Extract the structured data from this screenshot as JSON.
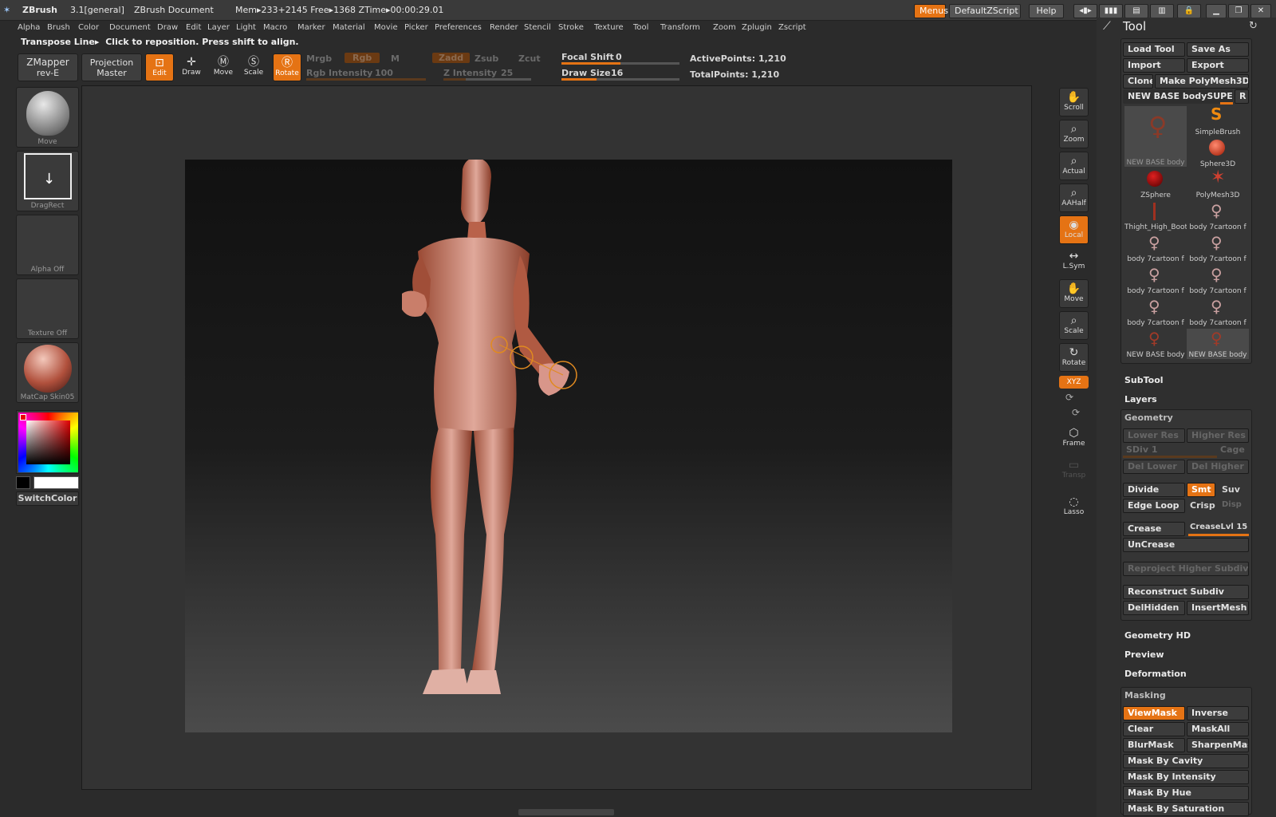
{
  "titlebar": {
    "app": "ZBrush",
    "version": "3.1[general]",
    "document": "ZBrush Document",
    "mem": "Mem▸233+2145 Free▸1368 ZTime▸00:00:29.01",
    "menus_btn": "Menus",
    "script_btn": "DefaultZScript",
    "help_btn": "Help"
  },
  "menus": [
    "Alpha",
    "Brush",
    "Color",
    "Document",
    "Draw",
    "Edit",
    "Layer",
    "Light",
    "Macro",
    "Marker",
    "Material",
    "Movie",
    "Picker",
    "Preferences",
    "Render",
    "Stencil",
    "Stroke",
    "Texture",
    "Tool",
    "Transform",
    "Zoom",
    "Zplugin",
    "Zscript"
  ],
  "status": {
    "label": "Transpose Line▸",
    "text": "Click to reposition. Press shift to align."
  },
  "toolbar": {
    "zmapper": "ZMapper",
    "zmapper_sub": "rev-E",
    "projection": "Projection",
    "projection_sub": "Master",
    "edit": "Edit",
    "draw": "Draw",
    "move": "Move",
    "scale": "Scale",
    "rotate": "Rotate",
    "mrgb": "Mrgb",
    "rgb": "Rgb",
    "m": "M",
    "zadd": "Zadd",
    "zsub": "Zsub",
    "zcut": "Zcut",
    "rgb_intensity_label": "Rgb Intensity",
    "rgb_intensity": "100",
    "z_intensity_label": "Z Intensity",
    "z_intensity": "25",
    "focal_shift_label": "Focal Shift",
    "focal_shift": "0",
    "draw_size_label": "Draw Size",
    "draw_size": "16",
    "active_points": "ActivePoints: 1,210",
    "total_points": "TotalPoints: 1,210"
  },
  "shelf": {
    "brush": "Move",
    "stroke": "DragRect",
    "alpha": "Alpha Off",
    "texture": "Texture Off",
    "material": "MatCap Skin05",
    "switch_color": "SwitchColor"
  },
  "nav": [
    "Scroll",
    "Zoom",
    "Actual",
    "AAHalf",
    "Local",
    "L.Sym",
    "Move",
    "Scale",
    "Rotate",
    "XYZ",
    "Frame",
    "Transp",
    "Lasso"
  ],
  "palette": {
    "title": "Tool",
    "load_tool": "Load Tool",
    "save_as": "Save As",
    "import": "Import",
    "export": "Export",
    "clone": "Clone",
    "make_polymesh": "Make PolyMesh3D",
    "current_tool": "NEW BASE bodySUPERGI",
    "r": "R",
    "thumbs": [
      "NEW BASE body",
      "SimpleBrush",
      "Sphere3D",
      "ZSphere",
      "PolyMesh3D",
      "Thight_High_Boot",
      "body 7cartoon f",
      "body 7cartoon f",
      "body 7cartoon f",
      "body 7cartoon f",
      "body 7cartoon f",
      "body 7cartoon f",
      "body 7cartoon f",
      "NEW BASE body",
      "NEW BASE body"
    ],
    "subtool": "SubTool",
    "layers": "Layers",
    "geometry": "Geometry",
    "lower_res": "Lower Res",
    "higher_res": "Higher Res",
    "sdiv": "SDiv 1",
    "cage": "Cage",
    "del_lower": "Del Lower",
    "del_higher": "Del Higher",
    "divide": "Divide",
    "smt": "Smt",
    "suv": "Suv",
    "edge_loop": "Edge Loop",
    "crisp": "Crisp",
    "disp": "Disp",
    "crease": "Crease",
    "creaselvl": "CreaseLvl 15",
    "uncrease": "UnCrease",
    "reproject": "Reproject Higher Subdiv",
    "reconstruct": "Reconstruct Subdiv",
    "delhidden": "DelHidden",
    "insertmesh": "InsertMesh",
    "geometry_hd": "Geometry HD",
    "preview": "Preview",
    "deformation": "Deformation",
    "masking": "Masking",
    "viewmask": "ViewMask",
    "inverse": "Inverse",
    "clear": "Clear",
    "maskall": "MaskAll",
    "blurmask": "BlurMask",
    "sharpenmask": "SharpenMask",
    "mask_cavity": "Mask By Cavity",
    "mask_intensity": "Mask By Intensity",
    "mask_hue": "Mask By Hue",
    "mask_saturation": "Mask By Saturation"
  },
  "colors": {
    "accent": "#e57314",
    "panel": "#3a3a3a",
    "background": "#2b2b2b"
  }
}
